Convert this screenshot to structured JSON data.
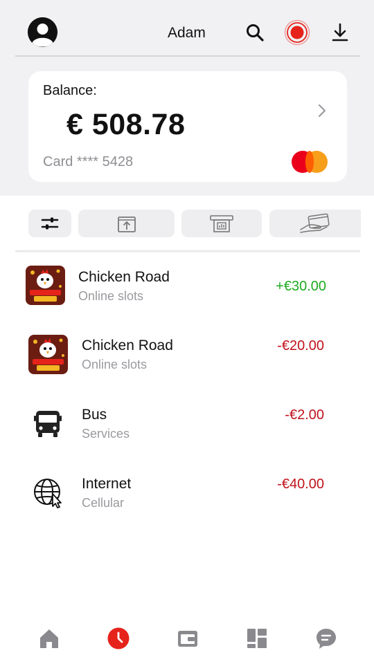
{
  "header": {
    "username": "Adam",
    "icons": [
      "avatar-icon",
      "search-icon",
      "record-icon",
      "download-icon"
    ]
  },
  "balance": {
    "label": "Balance:",
    "amount": "€ 508.78",
    "card": "Card **** 5428",
    "brand_colors": {
      "red": "#eb001b",
      "orange": "#f79e1b"
    }
  },
  "actions": [
    "filter-icon",
    "top-up-icon",
    "atm-icon",
    "card-payment-icon"
  ],
  "transactions": [
    {
      "title": "Chicken Road",
      "subtitle": "Online slots",
      "amount": "+€30.00",
      "icon": "chicken-road-icon",
      "color": "#1faa1f"
    },
    {
      "title": "Chicken Road",
      "subtitle": "Online slots",
      "amount": "-€20.00",
      "icon": "chicken-road-icon",
      "color": "#c0121b"
    },
    {
      "title": "Bus",
      "subtitle": "Services",
      "amount": "-€2.00",
      "icon": "bus-icon",
      "color": "#c0121b"
    },
    {
      "title": "Internet",
      "subtitle": "Cellular",
      "amount": "-€40.00",
      "icon": "globe-icon",
      "color": "#c0121b"
    }
  ],
  "nav": [
    "home-icon",
    "history-icon",
    "wallet-icon",
    "dashboard-icon",
    "chat-icon"
  ],
  "colors": {
    "accent": "#e5231b",
    "background": "#f1f1f3",
    "nav_gray": "#8a8a8e"
  }
}
